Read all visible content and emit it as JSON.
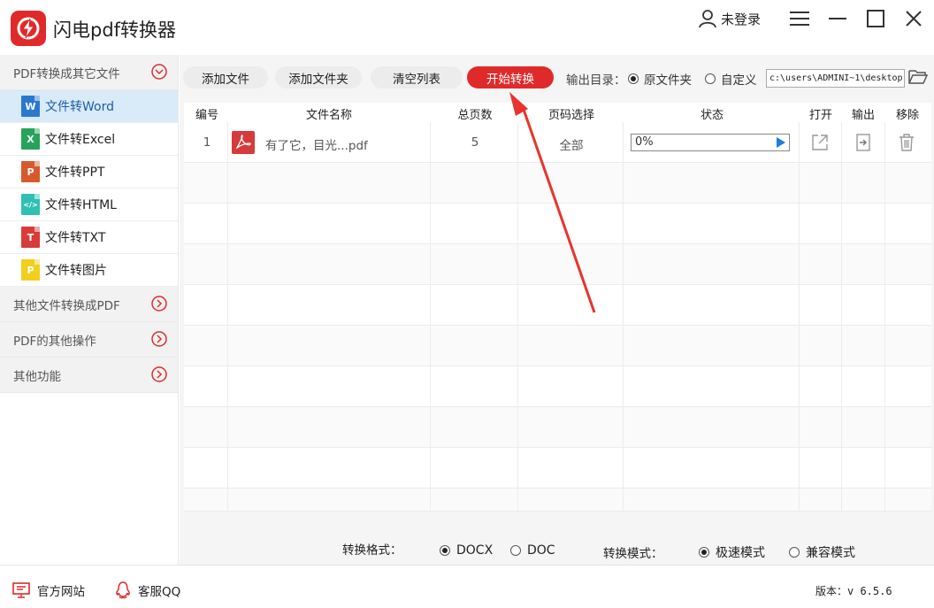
{
  "app": {
    "title": "闪电pdf转换器",
    "brand_color": "#e02a2a"
  },
  "user": {
    "label": "未登录"
  },
  "sidebar": {
    "groups": [
      {
        "label": "PDF转换成其它文件",
        "expanded": true
      },
      {
        "label": "其他文件转换成PDF",
        "expanded": false
      },
      {
        "label": "PDF的其他操作",
        "expanded": false
      },
      {
        "label": "其他功能",
        "expanded": false
      }
    ],
    "items": [
      {
        "label": "文件转Word",
        "icon": "W",
        "color": "#2b78d0",
        "active": true
      },
      {
        "label": "文件转Excel",
        "icon": "X",
        "color": "#27a35a"
      },
      {
        "label": "文件转PPT",
        "icon": "P",
        "color": "#d65a2c"
      },
      {
        "label": "文件转HTML",
        "icon": "</>",
        "color": "#2fc0b4"
      },
      {
        "label": "文件转TXT",
        "icon": "T",
        "color": "#d93a3a"
      },
      {
        "label": "文件转图片",
        "icon": "P",
        "color": "#f2cf1d"
      }
    ]
  },
  "toolbar": {
    "add_file": "添加文件",
    "add_folder": "添加文件夹",
    "clear_list": "清空列表",
    "start": "开始转换",
    "output_label": "输出目录：",
    "opt_source": "原文件夹",
    "opt_custom": "自定义",
    "path": "c:\\users\\ADMINI~1\\desktop"
  },
  "table": {
    "headers": [
      "编号",
      "文件名称",
      "总页数",
      "页码选择",
      "状态",
      "打开",
      "输出",
      "移除"
    ],
    "rows": [
      {
        "index": "1",
        "name": "有了它，目光...pdf",
        "pages": "5",
        "range": "全部",
        "status": "0%",
        "progress": 0
      }
    ]
  },
  "options": {
    "format_label": "转换格式：",
    "format_docx": "DOCX",
    "format_doc": "DOC",
    "mode_label": "转换模式：",
    "mode_fast": "极速模式",
    "mode_compat": "兼容模式"
  },
  "footer": {
    "website": "官方网站",
    "qq": "客服QQ",
    "version": "版本：v 6.5.6"
  }
}
